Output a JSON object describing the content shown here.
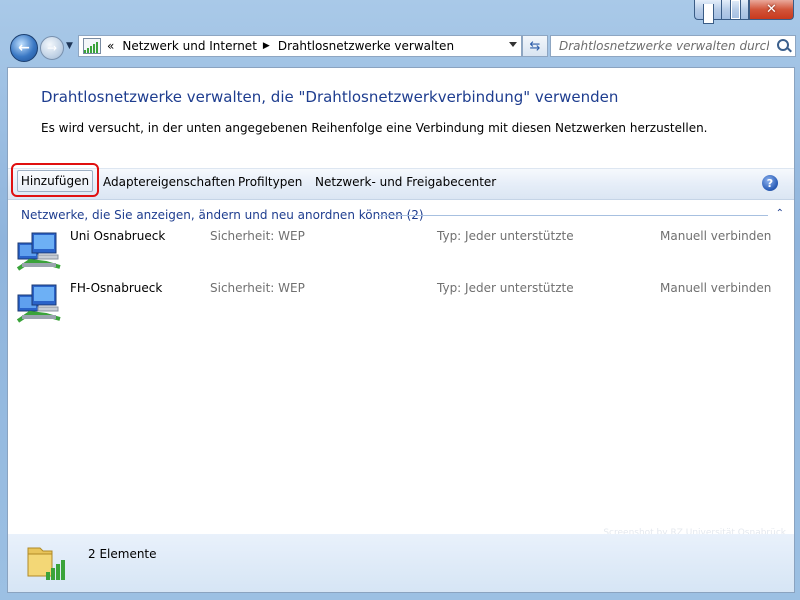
{
  "window": {
    "title_controls": {
      "minimize": "–",
      "maximize": "□",
      "close": "✕"
    }
  },
  "nav": {
    "back_icon": "back-arrow-icon",
    "forward_icon": "forward-arrow-icon",
    "breadcrumb_prefix": "«",
    "breadcrumbs": [
      "Netzwerk und Internet",
      "Drahtlosnetzwerke verwalten"
    ],
    "search_placeholder": "Drahtlosnetzwerke verwalten durchsu..."
  },
  "content": {
    "heading": "Drahtlosnetzwerke verwalten, die \"Drahtlosnetzwerkverbindung\" verwenden",
    "subtext": "Es wird versucht, in der unten angegebenen Reihenfolge eine Verbindung mit diesen Netzwerken herzustellen."
  },
  "toolbar": {
    "add": "Hinzufügen",
    "adapter": "Adaptereigenschaften",
    "profiles": "Profiltypen",
    "center": "Netzwerk- und Freigabecenter",
    "help": "?"
  },
  "group": {
    "header": "Netzwerke, die Sie anzeigen, ändern und neu anordnen können (2)",
    "collapse": "⌃"
  },
  "networks": [
    {
      "name": "Uni Osnabrueck",
      "security": "Sicherheit:  WEP",
      "type": "Typ:  Jeder unterstützte",
      "mode": "Manuell verbinden"
    },
    {
      "name": "FH-Osnabrueck",
      "security": "Sicherheit:  WEP",
      "type": "Typ:  Jeder unterstützte",
      "mode": "Manuell verbinden"
    }
  ],
  "watermark": "Screenshot by RZ Universität Osnabrück",
  "status": {
    "text": "2 Elemente"
  },
  "colors": {
    "heading": "#1e3d8f",
    "highlight": "#e01010",
    "signal": "#3aa33a"
  }
}
